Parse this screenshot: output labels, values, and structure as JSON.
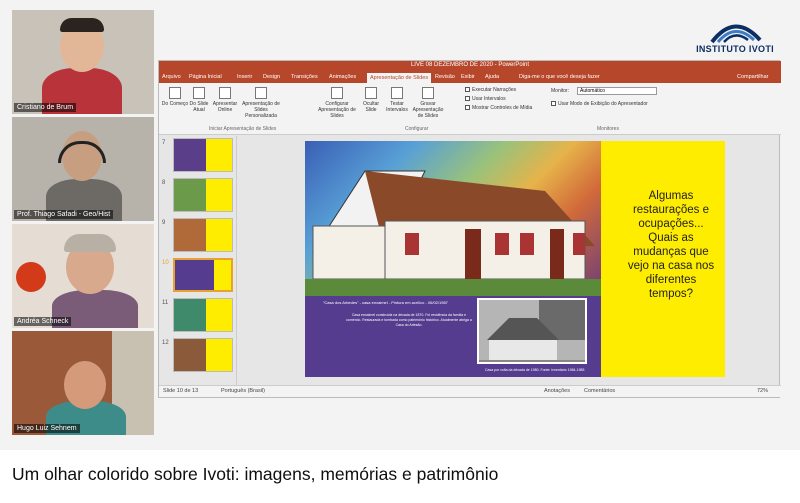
{
  "participants": [
    {
      "name": "Cristiano de Brum"
    },
    {
      "name": "Prof. Thiago Safadi - Geo/Hist"
    },
    {
      "name": "Andréa Schneck"
    },
    {
      "name": "Hugo Luiz Sehnem"
    }
  ],
  "logo": {
    "text": "INSTITUTO IVOTI"
  },
  "ppt": {
    "title": "LIVE 08 DEZEMBRO DE 2020 - PowerPoint",
    "share": "Compartilhar",
    "tabs": [
      "Arquivo",
      "Página Inicial",
      "Inserir",
      "Design",
      "Transições",
      "Animações",
      "Apresentação de Slides",
      "Revisão",
      "Exibir",
      "Ajuda",
      "Diga-me o que você deseja fazer"
    ],
    "ribbon": {
      "buttons": [
        "Do Começo",
        "Do Slide Atual",
        "Apresentar Online",
        "Apresentação de Slides Personalizada",
        "Configurar Apresentação de Slides",
        "Ocultar Slide",
        "Testar Intervalos",
        "Gravar Apresentação de Slides"
      ],
      "checks": [
        "Executar Narrações",
        "Usar Intervalos",
        "Mostrar Controles de Mídia"
      ],
      "monitor_label": "Monitor:",
      "monitor_value": "Automático",
      "presenter_check": "Usar Modo de Exibição do Apresentador",
      "groups": [
        "Iniciar Apresentação de Slides",
        "Configurar",
        "Monitores"
      ]
    },
    "thumb_numbers": [
      "7",
      "8",
      "9",
      "10",
      "11",
      "12"
    ],
    "slide": {
      "text": "Algumas restaurações e ocupações... Quais as mudanças que vejo na casa nos diferentes tempos?",
      "cap1": "\"Casa dos Arbedes\" - casa enxaimel - Pintura em acrílico - 06/02/1987",
      "captxt": "Casa enxaimel construída na década de 1870. Foi residência da família e comércio. Restaurada e tombada como patrimônio histórico. Atualmente abriga a Casa do Artesão.",
      "cap2": "Casa por volta da década de 1980. Fonte: Inventário 1984-1985"
    },
    "status": {
      "slide": "Slide 10 de 13",
      "lang": "Português (Brasil)",
      "notes": "Anotações",
      "comments": "Comentários",
      "zoom": "72%"
    }
  },
  "video_title": "Um olhar colorido sobre Ivoti: imagens, memórias e patrimônio"
}
